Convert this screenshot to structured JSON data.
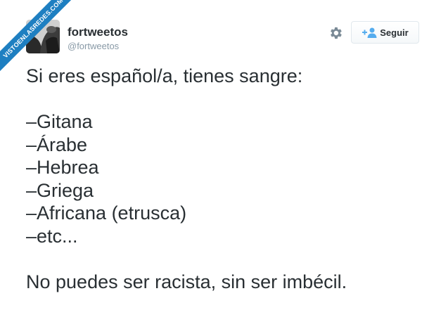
{
  "watermark": "VISTOENLASREDES.COM",
  "author": {
    "name": "fortweetos",
    "handle": "@fortweetos"
  },
  "actions": {
    "follow_label": "Seguir",
    "settings_icon": "gear-icon",
    "follow_icon": "add-user-icon"
  },
  "tweet": {
    "lines": [
      "Si eres español/a, tienes sangre:",
      "",
      "–Gitana",
      "–Árabe",
      "–Hebrea",
      "–Griega",
      "–Africana (etrusca)",
      "–etc...",
      "",
      "No puedes ser racista, sin ser imbécil."
    ]
  },
  "colors": {
    "text": "#292f33",
    "muted": "#8899a6",
    "follow_icon": "#55acee",
    "watermark": "#1e7fc1"
  }
}
